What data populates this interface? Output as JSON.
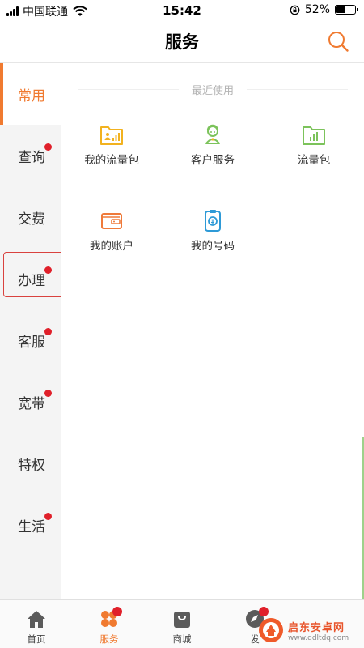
{
  "status_bar": {
    "carrier": "中国联通",
    "time": "15:42",
    "battery": "52%",
    "battery_level": 0.52,
    "icons": [
      "signal-icon",
      "wifi-icon",
      "orientation-lock-icon",
      "battery-icon"
    ]
  },
  "header": {
    "title": "服务",
    "search_icon": "search-icon"
  },
  "colors": {
    "accent": "#f07a30",
    "badge": "#e0202a",
    "sidebar_bg": "#f4f4f4",
    "highlight_border": "#d9423e"
  },
  "sidebar": {
    "items": [
      {
        "label": "常用",
        "active": true,
        "badge": false
      },
      {
        "label": "查询",
        "active": false,
        "badge": true
      },
      {
        "label": "交费",
        "active": false,
        "badge": false
      },
      {
        "label": "办理",
        "active": false,
        "badge": true
      },
      {
        "label": "客服",
        "active": false,
        "badge": true
      },
      {
        "label": "宽带",
        "active": false,
        "badge": true
      },
      {
        "label": "特权",
        "active": false,
        "badge": false
      },
      {
        "label": "生活",
        "active": false,
        "badge": true
      }
    ]
  },
  "main": {
    "section_title": "最近使用",
    "tiles": [
      {
        "label": "我的流量包",
        "icon": "data-package-icon"
      },
      {
        "label": "客户服务",
        "icon": "customer-service-icon"
      },
      {
        "label": "流量包",
        "icon": "folder-chart-icon"
      },
      {
        "label": "我的账户",
        "icon": "wallet-icon"
      },
      {
        "label": "我的号码",
        "icon": "sim-number-icon"
      }
    ]
  },
  "tabbar": {
    "tabs": [
      {
        "label": "首页",
        "icon": "home-icon",
        "active": false,
        "badge": false
      },
      {
        "label": "服务",
        "icon": "services-grid-icon",
        "active": true,
        "badge": true
      },
      {
        "label": "商城",
        "icon": "shopping-bag-icon",
        "active": false,
        "badge": false
      },
      {
        "label": "发",
        "icon": "discover-icon",
        "active": false,
        "badge": true
      }
    ]
  },
  "watermark": {
    "name": "启东安卓网",
    "url": "www.qdltdq.com",
    "logo_icon": "watermark-logo-icon"
  }
}
